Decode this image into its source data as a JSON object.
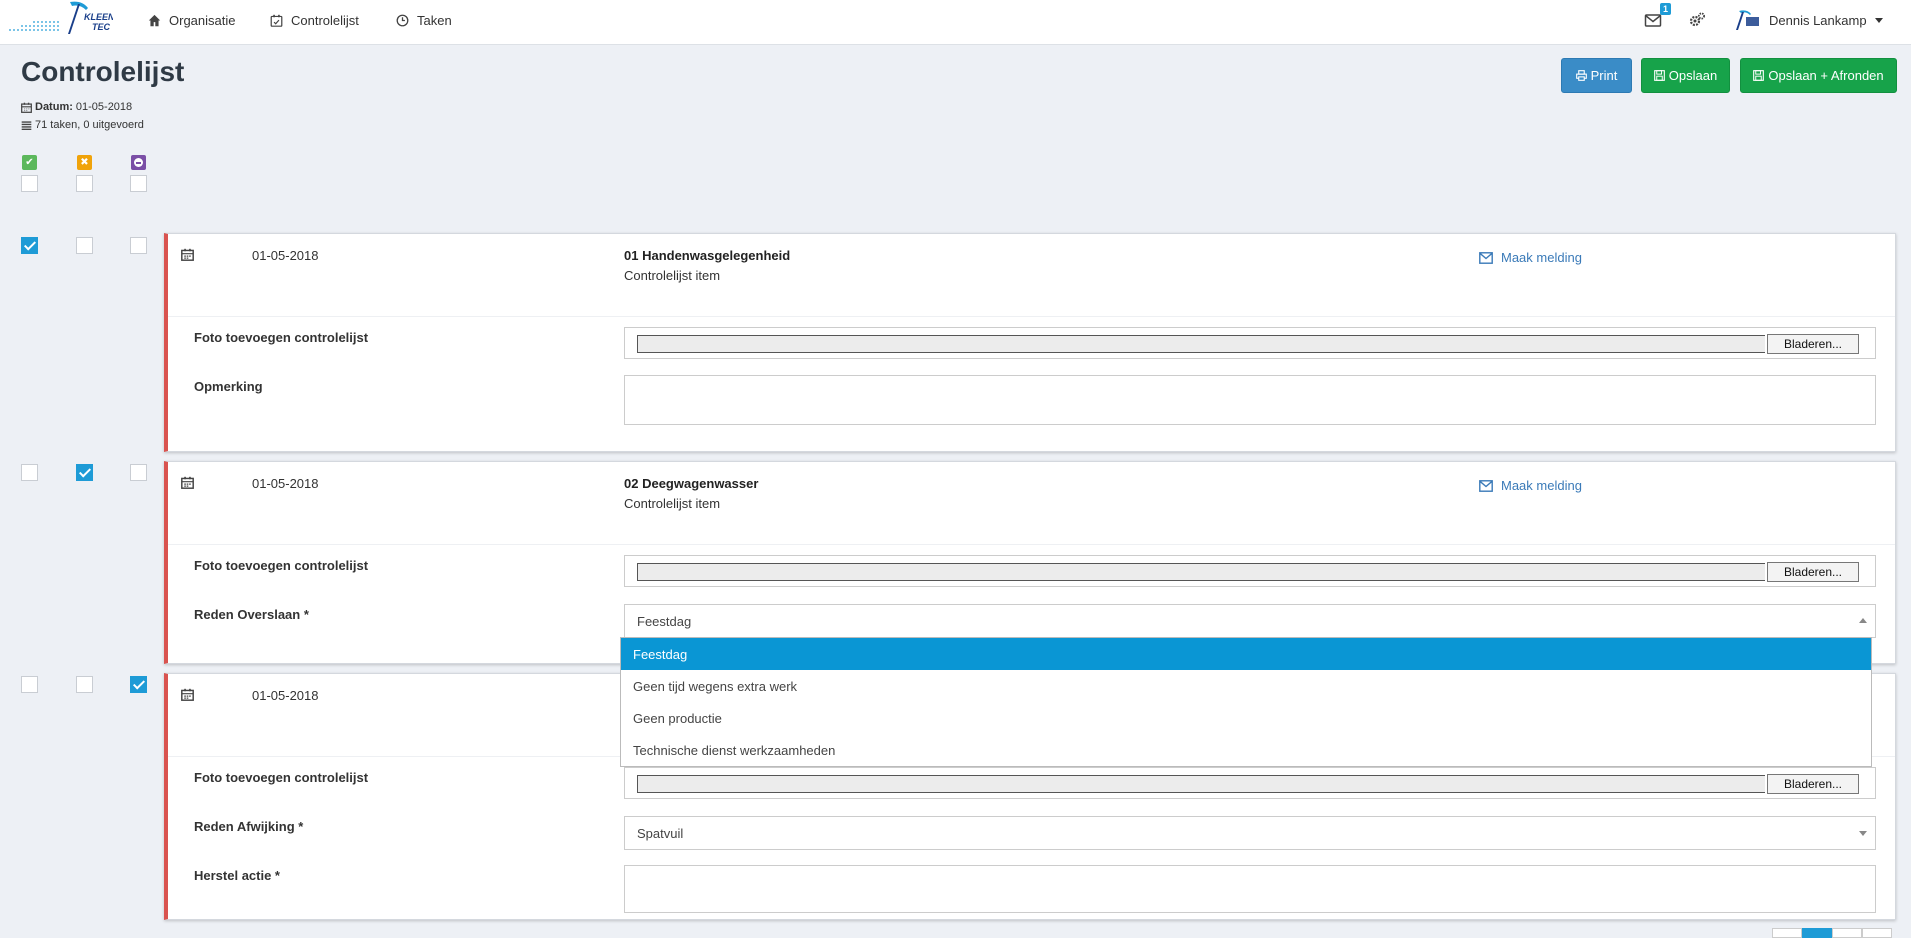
{
  "nav": {
    "brand": "KLEENTEC",
    "items": [
      {
        "label": "Organisatie",
        "icon": "home-icon"
      },
      {
        "label": "Controlelijst",
        "icon": "calendar-check-icon"
      },
      {
        "label": "Taken",
        "icon": "clock-icon"
      }
    ],
    "mail_count": "1",
    "user_name": "Dennis Lankamp"
  },
  "page": {
    "title": "Controlelijst",
    "datum_label": "Datum:",
    "datum_value": "01-05-2018",
    "tasks_summary": "71 taken, 0 uitgevoerd"
  },
  "actions": {
    "print": "Print",
    "save": "Opslaan",
    "save_finish": "Opslaan + Afronden"
  },
  "colors": {
    "accent": "#1e9bd6",
    "print_button": "#3a8cc7",
    "save_button": "#17a34a",
    "card_border": "#d9534f",
    "legend_ok": "#5cb85c",
    "legend_deviation": "#f0a30a",
    "legend_skip": "#7b4fa6"
  },
  "legend": [
    {
      "icon": "check-icon",
      "meaning": "uitgevoerd"
    },
    {
      "icon": "cross-icon",
      "meaning": "afwijking"
    },
    {
      "icon": "minus-icon",
      "meaning": "overslaan"
    }
  ],
  "items": [
    {
      "date": "01-05-2018",
      "title": "01 Handenwasgelegenheid",
      "subtitle": "Controlelijst item",
      "melding": "Maak melding",
      "photo_label": "Foto toevoegen controlelijst",
      "browse": "Bladeren...",
      "remark_label": "Opmerking",
      "status": "uitgevoerd"
    },
    {
      "date": "01-05-2018",
      "title": "02 Deegwagenwasser",
      "subtitle": "Controlelijst item",
      "melding": "Maak melding",
      "photo_label": "Foto toevoegen controlelijst",
      "browse": "Bladeren...",
      "reason_label": "Reden Overslaan *",
      "reason_value": "Feestdag",
      "reason_options": [
        "Feestdag",
        "Geen tijd wegens extra werk",
        "Geen productie",
        "Technische dienst werkzaamheden"
      ],
      "status": "afwijking"
    },
    {
      "date": "01-05-2018",
      "photo_label": "Foto toevoegen controlelijst",
      "browse": "Bladeren...",
      "reason_label": "Reden Afwijking *",
      "reason_value": "Spatvuil",
      "repair_label": "Herstel actie *",
      "status": "overslaan"
    }
  ]
}
